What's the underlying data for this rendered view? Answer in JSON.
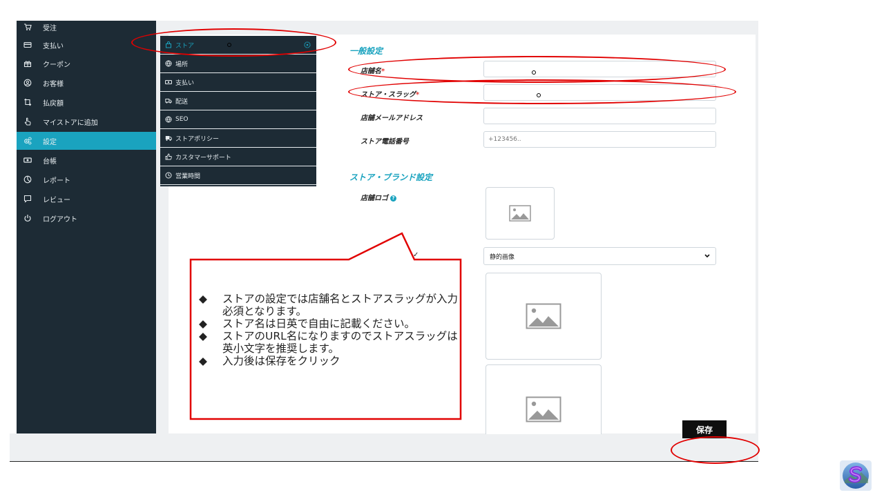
{
  "sidebar": {
    "items": [
      {
        "label": "受注",
        "icon": "cart-icon"
      },
      {
        "label": "支払い",
        "icon": "credit-card-icon"
      },
      {
        "label": "クーポン",
        "icon": "gift-icon"
      },
      {
        "label": "お客様",
        "icon": "user-circle-icon"
      },
      {
        "label": "払戻額",
        "icon": "refund-arrows-icon"
      },
      {
        "label": "マイストアに追加",
        "icon": "hand-pointer-icon"
      },
      {
        "label": "設定",
        "icon": "gears-icon",
        "active": true
      },
      {
        "label": "台帳",
        "icon": "money-bill-icon"
      },
      {
        "label": "レポート",
        "icon": "chart-pie-icon"
      },
      {
        "label": "レビュー",
        "icon": "comment-icon"
      },
      {
        "label": "ログアウト",
        "icon": "power-icon"
      }
    ]
  },
  "submenu": {
    "items": [
      {
        "label": "ストア",
        "icon": "store-icon",
        "active": true
      },
      {
        "label": "場所",
        "icon": "globe-icon"
      },
      {
        "label": "支払い",
        "icon": "money-bill-icon"
      },
      {
        "label": "配送",
        "icon": "truck-icon"
      },
      {
        "label": "SEO",
        "icon": "globe-icon"
      },
      {
        "label": "ストアポリシー",
        "icon": "truck-policy-icon"
      },
      {
        "label": "カスタマーサポート",
        "icon": "thumbs-up-icon"
      },
      {
        "label": "営業時間",
        "icon": "clock-icon"
      }
    ]
  },
  "form": {
    "general_title": "一般設定",
    "store_name_label": "店舗名",
    "store_slug_label": "ストア・スラッグ",
    "required_mark": "*",
    "email_label": "店舗メールアドレス",
    "phone_label": "ストア電話番号",
    "phone_placeholder": "+123456..",
    "brand_title": "ストア・ブランド設定",
    "logo_label": "店舗ロゴ",
    "info_mark": "?",
    "banner_type_value": "静的画像"
  },
  "footer": {
    "save_label": "保存"
  },
  "callout": {
    "bullet_mark": "◆",
    "lines": [
      "ストアの設定では店舗名とストアスラッグが入力必須となります。",
      "ストア名は日英で自由に記載ください。",
      "ストアのURL名になりますのでストアスラッグは英小文字を推奨します。",
      "入力後は保存をクリック"
    ]
  },
  "colors": {
    "sidebar_bg": "#1d2b35",
    "accent": "#1aa3bf",
    "annotation_red": "#e10000",
    "save_bg": "#0e0e0e"
  }
}
